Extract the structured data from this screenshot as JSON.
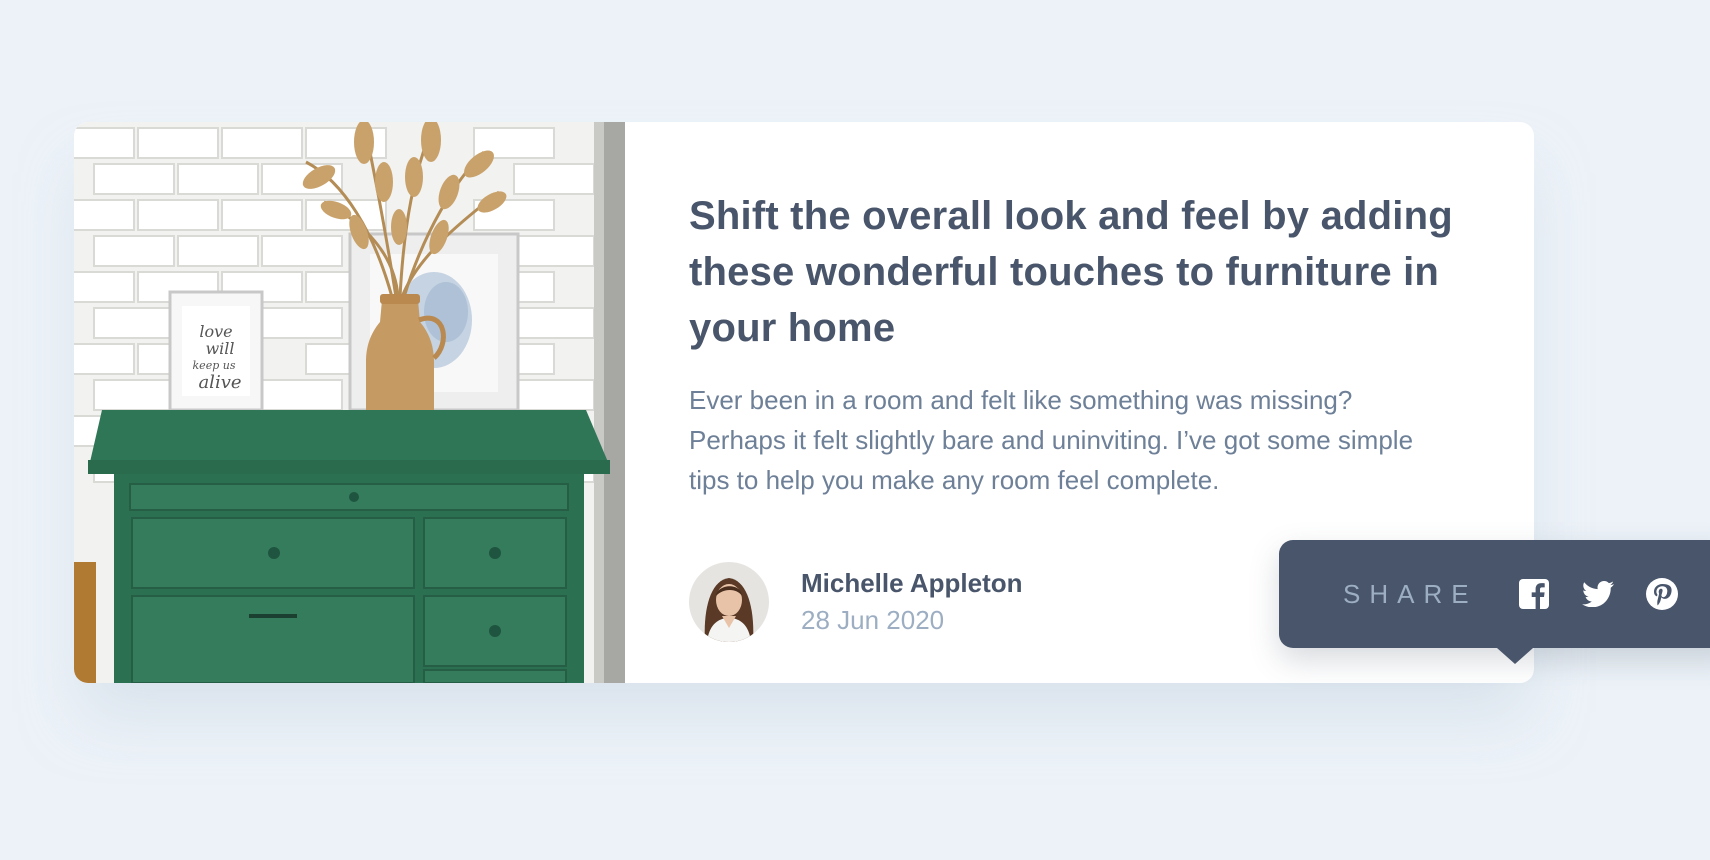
{
  "article": {
    "title": "Shift the overall look and feel by adding these wonderful touches to furniture in your home",
    "excerpt": "Ever been in a room and felt like something was missing? Perhaps it felt slightly bare and uninviting. I’ve got some simple tips to help you make any room feel complete.",
    "image_icon": "drawers-photo"
  },
  "author": {
    "name": "Michelle Appleton",
    "date": "28 Jun 2020",
    "avatar_icon": "avatar-photo"
  },
  "share": {
    "label": "SHARE",
    "button_icon": "share-icon",
    "networks": [
      {
        "name": "facebook",
        "icon": "facebook-icon"
      },
      {
        "name": "twitter",
        "icon": "twitter-icon"
      },
      {
        "name": "pinterest",
        "icon": "pinterest-icon"
      }
    ]
  },
  "colors": {
    "background": "#ecf2f8",
    "card": "#ffffff",
    "heading": "#48556a",
    "body_text": "#6e8098",
    "muted": "#9daec2",
    "popover": "#48556a",
    "share_button": "#6e8098"
  },
  "picture_lettering": [
    "love",
    "will",
    "keep us",
    "alive"
  ]
}
